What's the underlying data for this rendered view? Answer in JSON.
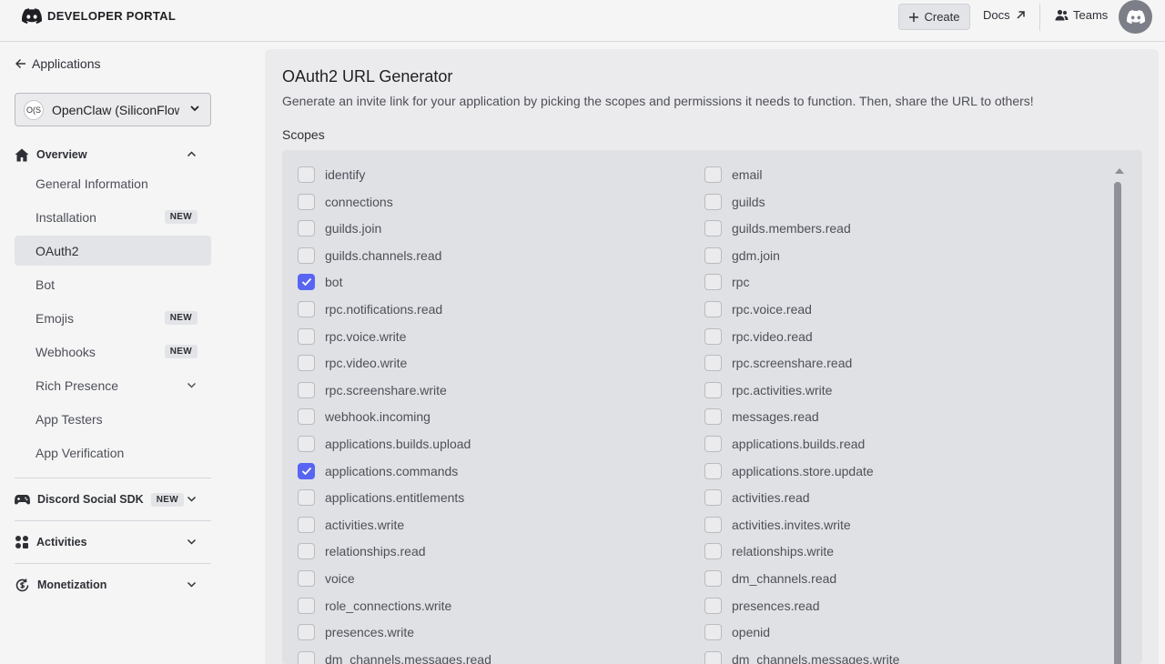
{
  "topbar": {
    "logo_text": "DEVELOPER PORTAL",
    "create_label": "Create",
    "docs_label": "Docs",
    "teams_label": "Teams"
  },
  "sidebar": {
    "back_label": "Applications",
    "app_badge": "O(S",
    "app_name": "OpenClaw (SiliconFlow",
    "overview_label": "Overview",
    "overview_items": [
      {
        "label": "General Information",
        "badge": ""
      },
      {
        "label": "Installation",
        "badge": "NEW"
      },
      {
        "label": "OAuth2",
        "badge": ""
      },
      {
        "label": "Bot",
        "badge": ""
      },
      {
        "label": "Emojis",
        "badge": "NEW"
      },
      {
        "label": "Webhooks",
        "badge": "NEW"
      },
      {
        "label": "Rich Presence",
        "badge": ""
      },
      {
        "label": "App Testers",
        "badge": ""
      },
      {
        "label": "App Verification",
        "badge": ""
      }
    ],
    "active_item": "OAuth2",
    "social_sdk_label": "Discord Social SDK",
    "social_sdk_badge": "NEW",
    "activities_label": "Activities",
    "monetization_label": "Monetization"
  },
  "main": {
    "title": "OAuth2 URL Generator",
    "description": "Generate an invite link for your application by picking the scopes and permissions it needs to function. Then, share the URL to others!",
    "scopes_label": "Scopes",
    "scopes_left": [
      {
        "label": "identify",
        "checked": false
      },
      {
        "label": "connections",
        "checked": false
      },
      {
        "label": "guilds.join",
        "checked": false
      },
      {
        "label": "guilds.channels.read",
        "checked": false
      },
      {
        "label": "bot",
        "checked": true
      },
      {
        "label": "rpc.notifications.read",
        "checked": false
      },
      {
        "label": "rpc.voice.write",
        "checked": false
      },
      {
        "label": "rpc.video.write",
        "checked": false
      },
      {
        "label": "rpc.screenshare.write",
        "checked": false
      },
      {
        "label": "webhook.incoming",
        "checked": false
      },
      {
        "label": "applications.builds.upload",
        "checked": false
      },
      {
        "label": "applications.commands",
        "checked": true
      },
      {
        "label": "applications.entitlements",
        "checked": false
      },
      {
        "label": "activities.write",
        "checked": false
      },
      {
        "label": "relationships.read",
        "checked": false
      },
      {
        "label": "voice",
        "checked": false
      },
      {
        "label": "role_connections.write",
        "checked": false
      },
      {
        "label": "presences.write",
        "checked": false
      },
      {
        "label": "dm_channels.messages.read",
        "checked": false
      }
    ],
    "scopes_right": [
      {
        "label": "email",
        "checked": false
      },
      {
        "label": "guilds",
        "checked": false
      },
      {
        "label": "guilds.members.read",
        "checked": false
      },
      {
        "label": "gdm.join",
        "checked": false
      },
      {
        "label": "rpc",
        "checked": false
      },
      {
        "label": "rpc.voice.read",
        "checked": false
      },
      {
        "label": "rpc.video.read",
        "checked": false
      },
      {
        "label": "rpc.screenshare.read",
        "checked": false
      },
      {
        "label": "rpc.activities.write",
        "checked": false
      },
      {
        "label": "messages.read",
        "checked": false
      },
      {
        "label": "applications.builds.read",
        "checked": false
      },
      {
        "label": "applications.store.update",
        "checked": false
      },
      {
        "label": "activities.read",
        "checked": false
      },
      {
        "label": "activities.invites.write",
        "checked": false
      },
      {
        "label": "relationships.write",
        "checked": false
      },
      {
        "label": "dm_channels.read",
        "checked": false
      },
      {
        "label": "presences.read",
        "checked": false
      },
      {
        "label": "openid",
        "checked": false
      },
      {
        "label": "dm_channels.messages.write",
        "checked": false
      }
    ]
  },
  "colors": {
    "accent": "#5865f2",
    "panel": "#ebebed",
    "scopes_bg": "#e0e1e5"
  },
  "icons": [
    "discord-logo-icon",
    "plus-icon",
    "external-arrow-icon",
    "teams-icon",
    "discord-avatar-icon",
    "back-arrow-icon",
    "chevron-down-icon",
    "chevron-up-icon",
    "home-icon",
    "gamepad-icon",
    "activities-icon",
    "monetization-icon",
    "checkmark-icon"
  ]
}
